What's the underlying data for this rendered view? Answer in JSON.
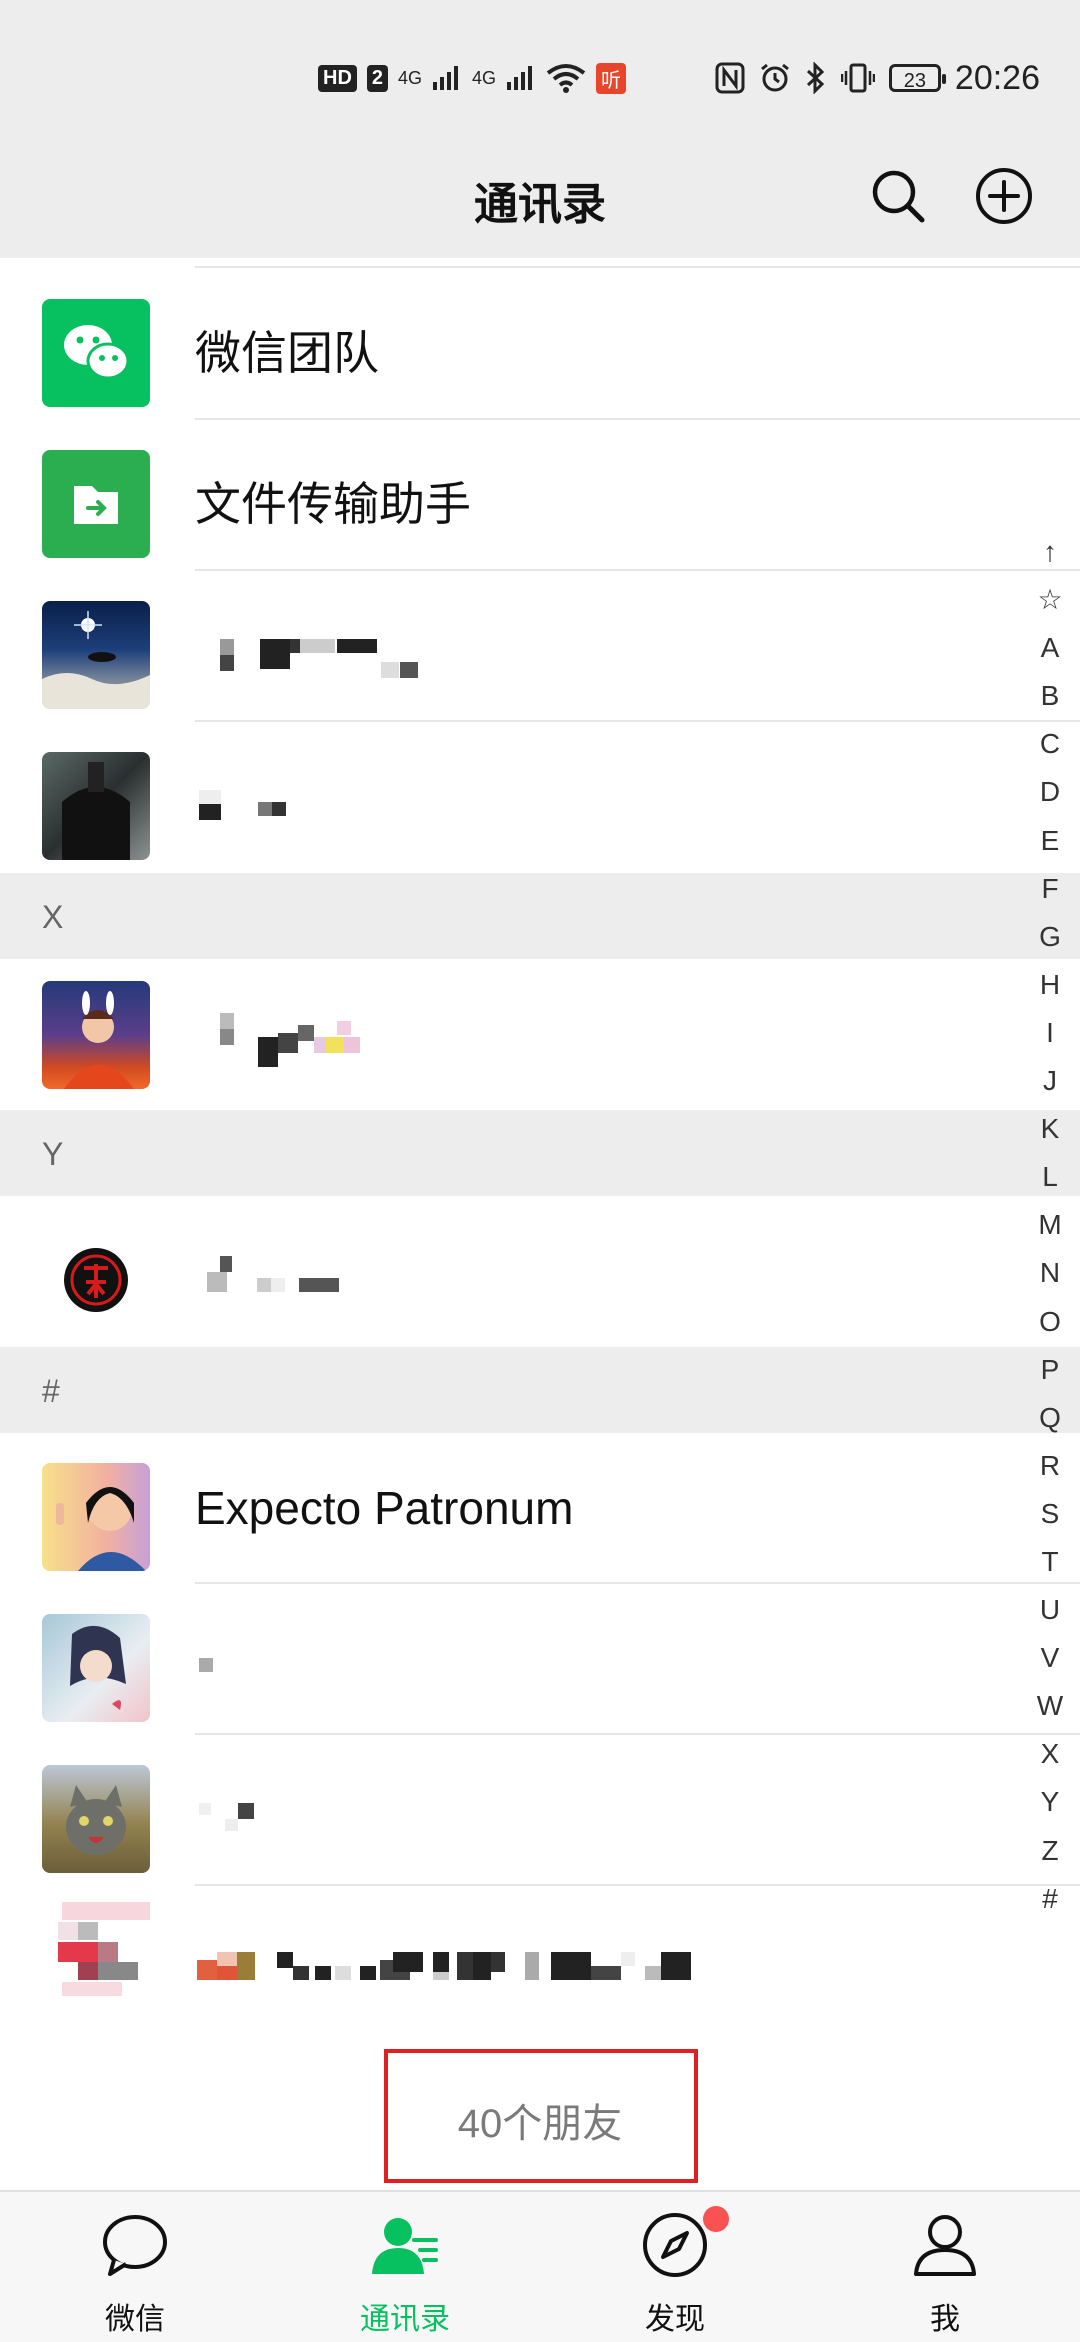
{
  "status_bar": {
    "left_badges": [
      "HD",
      "2",
      "4G",
      "4G",
      "听"
    ],
    "battery_level": "23",
    "time": "20:26"
  },
  "header": {
    "title": "通讯录"
  },
  "contacts_top": [
    {
      "name": "微信团队",
      "avatar_icon": "wechat-team-icon"
    },
    {
      "name": "文件传输助手",
      "avatar_icon": "file-transfer-icon"
    }
  ],
  "sections": [
    {
      "letter": "X"
    },
    {
      "letter": "Y"
    },
    {
      "letter": "#"
    }
  ],
  "contacts_hash": [
    {
      "name": "Expecto Patronum"
    }
  ],
  "alphabet_index": [
    "↑",
    "☆",
    "A",
    "B",
    "C",
    "D",
    "E",
    "F",
    "G",
    "H",
    "I",
    "J",
    "K",
    "L",
    "M",
    "N",
    "O",
    "P",
    "Q",
    "R",
    "S",
    "T",
    "U",
    "V",
    "W",
    "X",
    "Y",
    "Z",
    "#"
  ],
  "footer": {
    "friend_count": "40个朋友"
  },
  "tabs": [
    {
      "label": "微信",
      "icon": "chat-bubble-icon",
      "active": false
    },
    {
      "label": "通讯录",
      "icon": "contacts-icon",
      "active": true
    },
    {
      "label": "发现",
      "icon": "compass-icon",
      "active": false,
      "badge_dot": true
    },
    {
      "label": "我",
      "icon": "person-icon",
      "active": false
    }
  ],
  "colors": {
    "brand_green": "#07c160",
    "highlight_red": "#e02020",
    "badge_red": "#fa5151"
  }
}
